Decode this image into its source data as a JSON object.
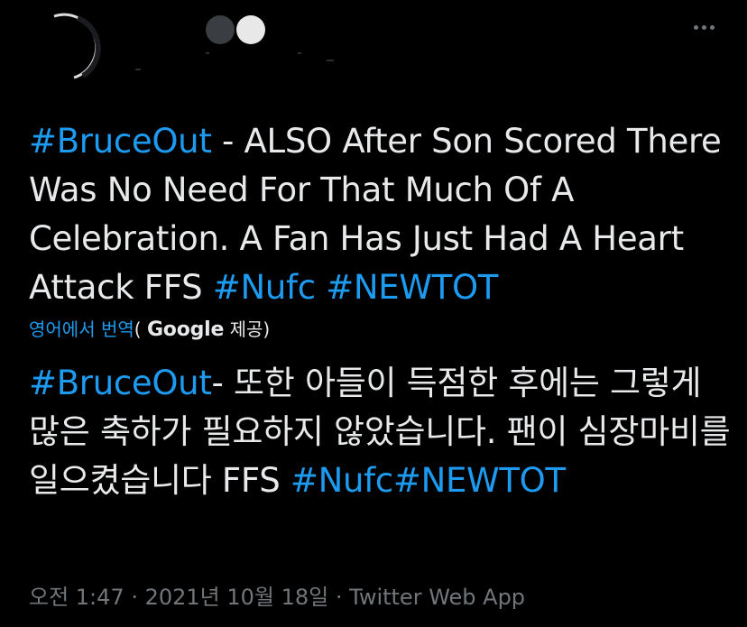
{
  "tweet": {
    "text_parts": [
      {
        "text": "#BruceOut",
        "hashtag": true
      },
      {
        "text": " - ALSO After Son Scored There Was No Need For That Much Of A Celebration. A Fan Has Just Had A Heart Attack FFS ",
        "hashtag": false
      },
      {
        "text": "#Nufc",
        "hashtag": true
      },
      {
        "text": " ",
        "hashtag": false
      },
      {
        "text": "#NEWTOT",
        "hashtag": true
      }
    ]
  },
  "translation": {
    "link_label": "영어에서 번역",
    "paren_open": "(",
    "provider": "Google",
    "provided_by": " 제공)",
    "text_parts": [
      {
        "text": "#BruceOut",
        "hashtag": true
      },
      {
        "text": "- 또한 아들이 득점한 후에는 그렇게 많은 축하가 필요하지 않았습니다. 팬이 심장마비를 일으켰습니다 FFS ",
        "hashtag": false
      },
      {
        "text": "#Nufc",
        "hashtag": true
      },
      {
        "text": "#NEWTOT",
        "hashtag": true
      }
    ]
  },
  "meta": {
    "time": "오전 1:47",
    "sep1": " · ",
    "date": "2021년 10월 18일",
    "sep2": " · ",
    "source": "Twitter Web App"
  },
  "icons": {
    "more": "more-horizontal-icon"
  },
  "colors": {
    "background": "#000000",
    "text": "#e7e9ea",
    "hashtag": "#1d9bf0",
    "secondary": "#71767b"
  }
}
